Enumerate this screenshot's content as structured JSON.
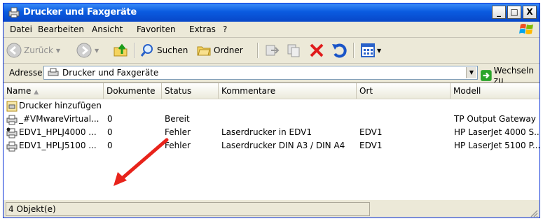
{
  "window": {
    "title": "Drucker und Faxgeräte",
    "min_glyph": "_",
    "max_glyph": "□",
    "close_glyph": "X"
  },
  "menu": [
    "Datei",
    "Bearbeiten",
    "Ansicht",
    "Favoriten",
    "Extras",
    "?"
  ],
  "toolbar": {
    "back_label": "Zurück",
    "search_label": "Suchen",
    "folders_label": "Ordner"
  },
  "address": {
    "label": "Adresse",
    "value": "Drucker und Faxgeräte",
    "go_label": "Wechseln zu"
  },
  "columns": [
    "Name",
    "Dokumente",
    "Status",
    "Kommentare",
    "Ort",
    "Modell"
  ],
  "rows": [
    {
      "name": "Drucker hinzufügen",
      "docs": "",
      "status": "",
      "comment": "",
      "location": "",
      "model": "",
      "icon": "add-printer-icon"
    },
    {
      "name": "_#VMwareVirtual...",
      "docs": "0",
      "status": "Bereit",
      "comment": "",
      "location": "",
      "model": "TP Output Gateway",
      "icon": "printer-icon"
    },
    {
      "name": "EDV1_HPLJ4000 ...",
      "docs": "0",
      "status": "Fehler",
      "comment": "Laserdrucker in EDV1",
      "location": "EDV1",
      "model": "HP LaserJet 4000 S...",
      "icon": "default-printer-icon"
    },
    {
      "name": "EDV1_HPLJ5100 ...",
      "docs": "0",
      "status": "Fehler",
      "comment": "Laserdrucker DIN A3 / DIN A4",
      "location": "EDV1",
      "model": "HP LaserJet 5100 P...",
      "icon": "printer-icon"
    }
  ],
  "status": {
    "text": "4 Objekt(e)"
  },
  "colors": {
    "titlebar": "#0a5be0",
    "annotation_arrow": "#e8231b"
  }
}
